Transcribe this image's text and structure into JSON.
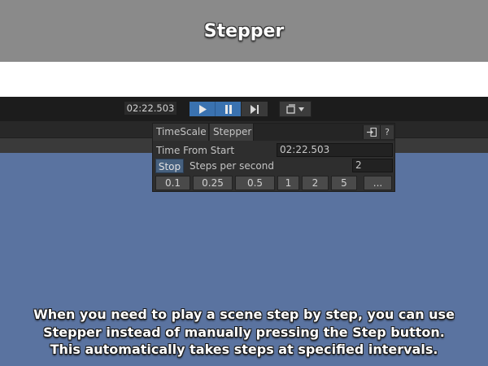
{
  "banner": {
    "title": "Stepper"
  },
  "toolbar": {
    "time": "02:22.503",
    "play_icon": "play-icon",
    "pause_icon": "pause-icon",
    "step_icon": "step-icon",
    "layout_icon": "layers-icon"
  },
  "panel": {
    "tabs": [
      "TimeScale",
      "Stepper"
    ],
    "help_label": "?",
    "time_from_start_label": "Time From Start",
    "time_from_start_value": "02:22.503",
    "stop_label": "Stop",
    "steps_per_second_label": "Steps per second",
    "steps_per_second_value": "2",
    "presets": [
      "0.1",
      "0.25",
      "0.5",
      "1",
      "2",
      "5",
      "..."
    ]
  },
  "caption": {
    "lines": [
      "When you need to play a scene step by step, you can use",
      "Stepper instead of manually pressing the Step button.",
      "This automatically takes steps at specified intervals."
    ]
  },
  "colors": {
    "accent": "#3a72b0",
    "scene_background": "#5a73a0",
    "banner": "#8a8a8a"
  }
}
